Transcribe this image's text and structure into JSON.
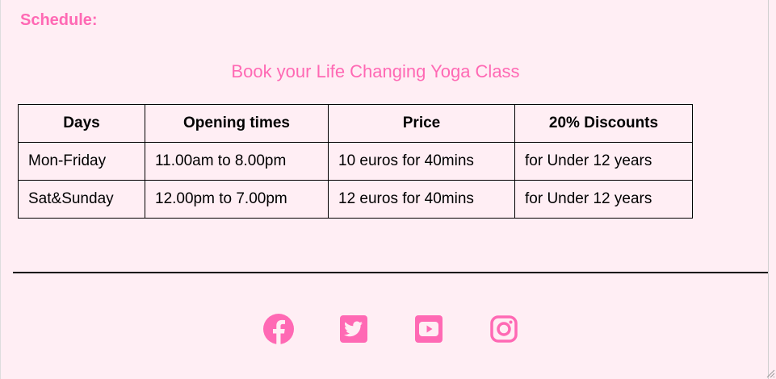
{
  "heading": "Schedule:",
  "subtitle": "Book your Life Changing Yoga Class",
  "table": {
    "headers": [
      "Days",
      "Opening times",
      "Price",
      "20% Discounts"
    ],
    "rows": [
      [
        "Mon-Friday",
        "11.00am to 8.00pm",
        "10 euros for 40mins",
        "for Under 12 years"
      ],
      [
        "Sat&Sunday",
        "12.00pm to 7.00pm",
        "12 euros for 40mins",
        "for Under 12 years"
      ]
    ]
  },
  "social": {
    "icons": [
      "facebook-icon",
      "twitter-icon",
      "youtube-icon",
      "instagram-icon"
    ]
  },
  "colors": {
    "accent": "#ff69b4",
    "background": "#ffeef4",
    "text": "#000000"
  }
}
